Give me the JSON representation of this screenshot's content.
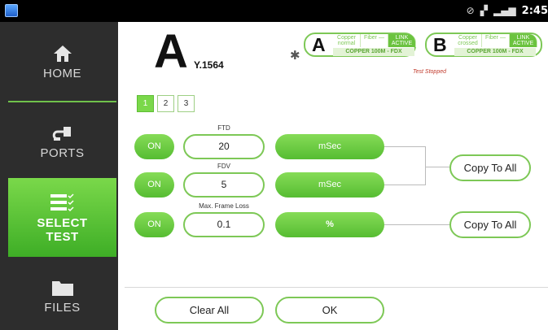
{
  "statusbar": {
    "time": "2:45",
    "icons": [
      "app-icon",
      "gps-icon",
      "phone-icon",
      "signal-icon"
    ]
  },
  "sidebar": {
    "items": [
      {
        "label": "HOME",
        "icon": "home-icon"
      },
      {
        "label": "PORTS",
        "icon": "ports-icon"
      },
      {
        "label": "SELECT",
        "label2": "TEST",
        "icon": "checklist-icon",
        "active": true
      },
      {
        "label": "FILES",
        "icon": "folder-icon"
      }
    ]
  },
  "header": {
    "port_letter": "A",
    "test_name": "Y.1564"
  },
  "links": [
    {
      "letter": "A",
      "cells": [
        "Copper normal",
        "Fiber —",
        "LINK ACTIVE"
      ],
      "status": "COPPER 100M  - FDX"
    },
    {
      "letter": "B",
      "cells": [
        "Copper crossed",
        "Fiber —",
        "LINK ACTIVE"
      ],
      "status": "COPPER 100M  - FDX"
    }
  ],
  "test_status": "Test Stopped",
  "tabs": [
    "1",
    "2",
    "3"
  ],
  "rows": [
    {
      "label": "FTD",
      "toggle": "ON",
      "value": "20",
      "unit": "mSec"
    },
    {
      "label": "FDV",
      "toggle": "ON",
      "value": "5",
      "unit": "mSec"
    },
    {
      "label": "Max. Frame Loss",
      "toggle": "ON",
      "value": "0.1",
      "unit": "%"
    }
  ],
  "copy_buttons": [
    "Copy To All",
    "Copy To All"
  ],
  "footer": {
    "clear_label": "Clear All",
    "ok_label": "OK"
  },
  "colors": {
    "accent": "#6bc33f",
    "sidebar_bg": "#2d2d2d",
    "stopped": "#c0392b"
  }
}
